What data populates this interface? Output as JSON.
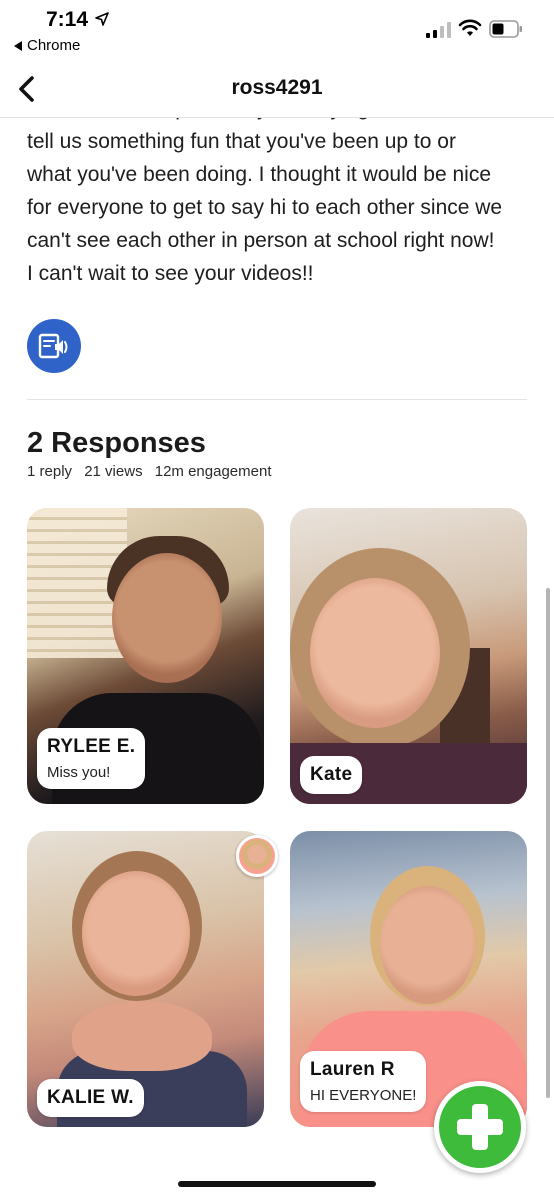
{
  "status_bar": {
    "time": "7:14",
    "back_app": "Chrome"
  },
  "nav": {
    "title": "ross4291"
  },
  "description": {
    "lines": [
      "share a short clip of everyone saying \"hi.\" You can",
      "tell us something fun that you've been up to or",
      "what you've been doing. I thought it would be nice",
      "for everyone to get to say hi to each other since we",
      "can't see each other in person at school right now!",
      "I can't wait to see your videos!!"
    ]
  },
  "responses": {
    "title": "2 Responses",
    "stats": [
      "1 reply",
      "21 views",
      "12m engagement"
    ],
    "cards": [
      {
        "name": "RYLEE E.",
        "message": "Miss you!"
      },
      {
        "name": "Kate",
        "message": ""
      },
      {
        "name": "KALIE W.",
        "message": ""
      },
      {
        "name": "Lauren R",
        "message": "HI EVERYONE!"
      }
    ]
  },
  "icons": {
    "audio": "audio-description-icon",
    "add": "plus-icon",
    "back": "chevron-left-icon"
  },
  "colors": {
    "audio_button": "#2f63c8",
    "add_button": "#3fbb3c"
  }
}
